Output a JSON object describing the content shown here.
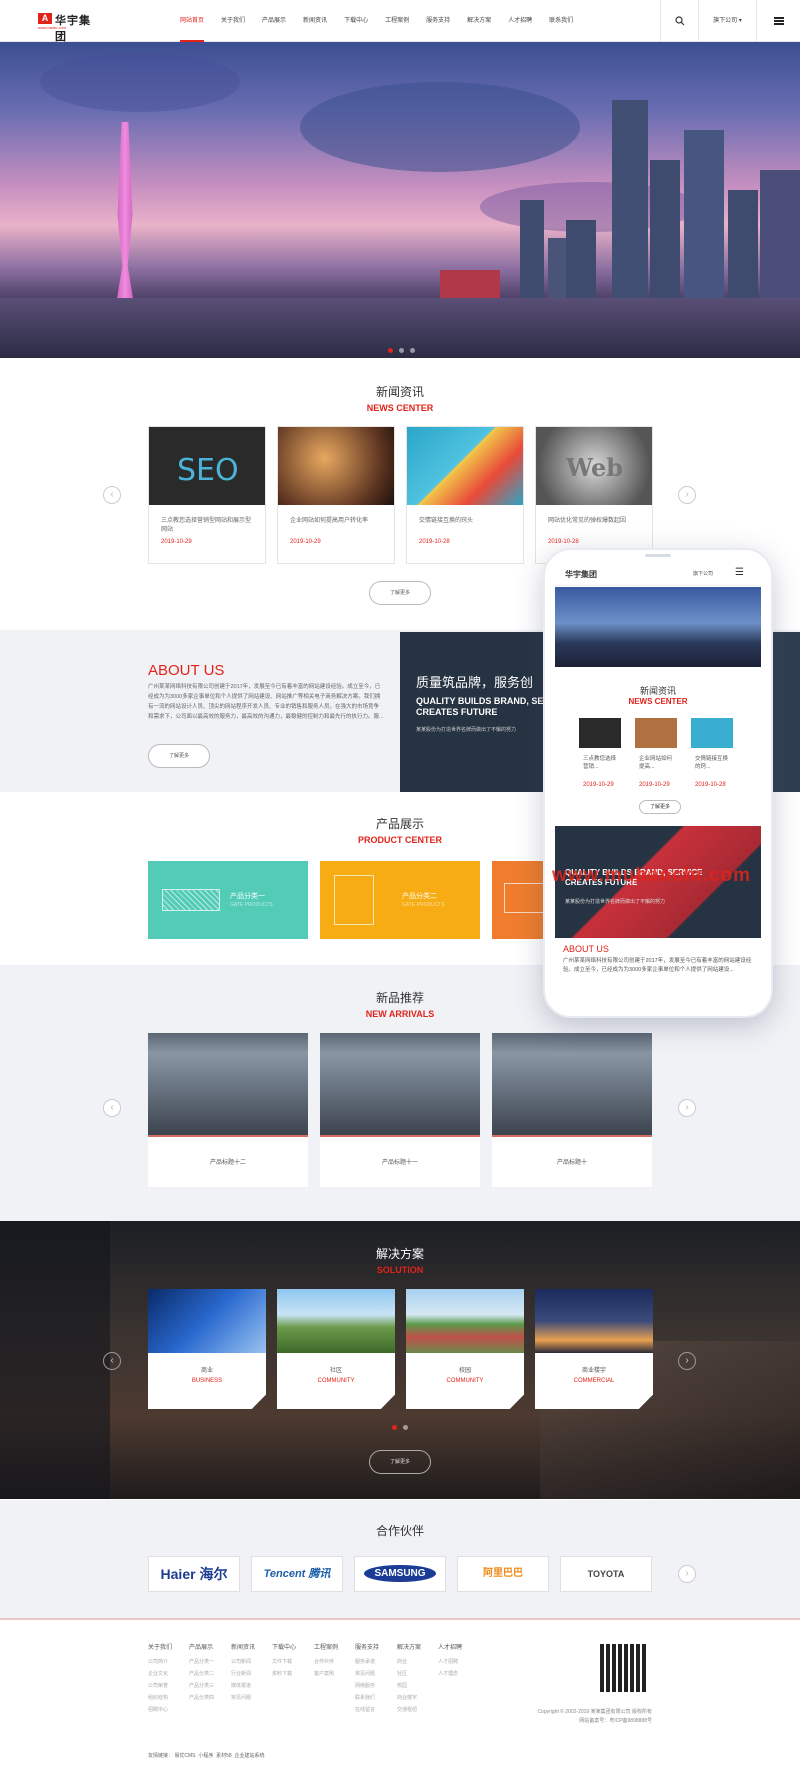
{
  "header": {
    "logo_cn": "华宇集团",
    "logo_sub": "www.baidu.com",
    "nav": [
      "网站首页",
      "关于我们",
      "产品展示",
      "新闻资讯",
      "下载中心",
      "工程案例",
      "服务支持",
      "解决方案",
      "人才招聘",
      "联系我们"
    ],
    "subsidiary": "旗下公司"
  },
  "news": {
    "title_cn": "新闻资讯",
    "title_en": "NEWS CENTER",
    "items": [
      {
        "title": "三点教您选择营销型网站和展示型网站",
        "date": "2019-10-29"
      },
      {
        "title": "企业网站如何提高用户转化率",
        "date": "2019-10-29"
      },
      {
        "title": "交情链接互换的窍头",
        "date": "2019-10-28"
      },
      {
        "title": "网站优化常见的弹权爆数起因",
        "date": "2019-10-28"
      }
    ],
    "more": "了解更多"
  },
  "about": {
    "title": "ABOUT US",
    "text": "广州某某网络科技有限公司创建于2017年，发展至今已有着丰富的网站建设经验。成立至今，已经成为为3000多家企事单位和个人提供了网站建设、网站推广等相关电子商务解决方案。我们拥有一流的网站设计人员、顶尖的网站程序开发人员、专业的销售和服务人员，在强大的市场竞争和需求下，公司面以最高效的服务力，最高效的沟通力，最稳健的控制力和最先行的执行力。服...",
    "more": "了解更多",
    "slogan_cn": "质量筑品牌，服务创",
    "slogan_en": "QUALITY BUILDS BRAND, SERVICE CREATES FUTURE",
    "slogan_sub": "某某股份为打造世界名牌而做出了不懈的努力"
  },
  "products": {
    "title_cn": "产品展示",
    "title_en": "PRODUCT CENTER",
    "items": [
      {
        "name": "产品分类一",
        "en": "GATE PRODUCTS",
        "color": "#53ccb7"
      },
      {
        "name": "产品分类二",
        "en": "GATE PRODUCTS",
        "color": "#f6ac12"
      },
      {
        "name": "",
        "en": "",
        "color": "#ef7d2d"
      }
    ]
  },
  "arrivals": {
    "title_cn": "新品推荐",
    "title_en": "NEW ARRIVALS",
    "items": [
      "产品标题十二",
      "产品标题十一",
      "产品标题十"
    ]
  },
  "solution": {
    "title_cn": "解决方案",
    "title_en": "SOLUTION",
    "items": [
      {
        "cn": "商业",
        "en": "BUSINESS"
      },
      {
        "cn": "社区",
        "en": "COMMUNITY"
      },
      {
        "cn": "校园",
        "en": "COMMUNITY"
      },
      {
        "cn": "商业楼宇",
        "en": "COMMERCIAL"
      }
    ],
    "more": "了解更多"
  },
  "partners": {
    "title": "合作伙伴",
    "logos": [
      "Haier 海尔",
      "Tencent 腾讯",
      "SAMSUNG",
      "阿里巴巴",
      "TOYOTA"
    ]
  },
  "footer": {
    "cols": [
      {
        "h": "关于我们",
        "i": [
          "公司简介",
          "企业文化",
          "公司荣誉",
          "组织结构",
          "招聘中心"
        ]
      },
      {
        "h": "产品展示",
        "i": [
          "产品分类一",
          "产品分类二",
          "产品分类三",
          "产品分类四"
        ]
      },
      {
        "h": "新闻资讯",
        "i": [
          "公司新闻",
          "行业新闻",
          "媒体报道",
          "常见问题"
        ]
      },
      {
        "h": "下载中心",
        "i": [
          "文件下载",
          "资料下载"
        ]
      },
      {
        "h": "工程案例",
        "i": [
          "合作伙伴",
          "客户案例"
        ]
      },
      {
        "h": "服务支持",
        "i": [
          "服务承诺",
          "常见问题",
          "网络服务",
          "联系我们",
          "在线留言"
        ]
      },
      {
        "h": "解决方案",
        "i": [
          "商业",
          "社区",
          "校园",
          "商业楼宇",
          "交通枢纽"
        ]
      },
      {
        "h": "人才招聘",
        "i": [
          "人才招聘",
          "人才理念"
        ]
      }
    ],
    "copyright": "Copyright © 2002-2019 某某集团有限公司 版权所有",
    "icp": "网站备案号：粤ICP备9898888号",
    "links_label": "友情链接：",
    "links": [
      "易优CMS",
      "小程序",
      "素材58",
      "企业建站系统"
    ]
  },
  "phone": {
    "logo": "华宇集团",
    "sub": "旗下公司",
    "news_cn": "新闻资讯",
    "news_en": "NEWS CENTER",
    "items": [
      {
        "t": "三点教您选择营销...",
        "d": "2019-10-29"
      },
      {
        "t": "企业网站如何提高...",
        "d": "2019-10-29"
      },
      {
        "t": "交情链接互换的窍...",
        "d": "2019-10-28"
      }
    ],
    "more": "了解更多",
    "slogan_en": "QUALITY BUILDS BRAND, SERVICE CREATES FUTURE",
    "slogan_sub": "某某股份为打造世界名牌而做出了不懈的努力",
    "about_h": "ABOUT US",
    "about_p": "广州某某网络科技有限公司创建于2017年，发展至今已有着丰富的网站建设经验。成立至今，已经成为为3000多家企事单位和个人提供了网站建设..."
  },
  "watermark": "www.mubaochi.com"
}
